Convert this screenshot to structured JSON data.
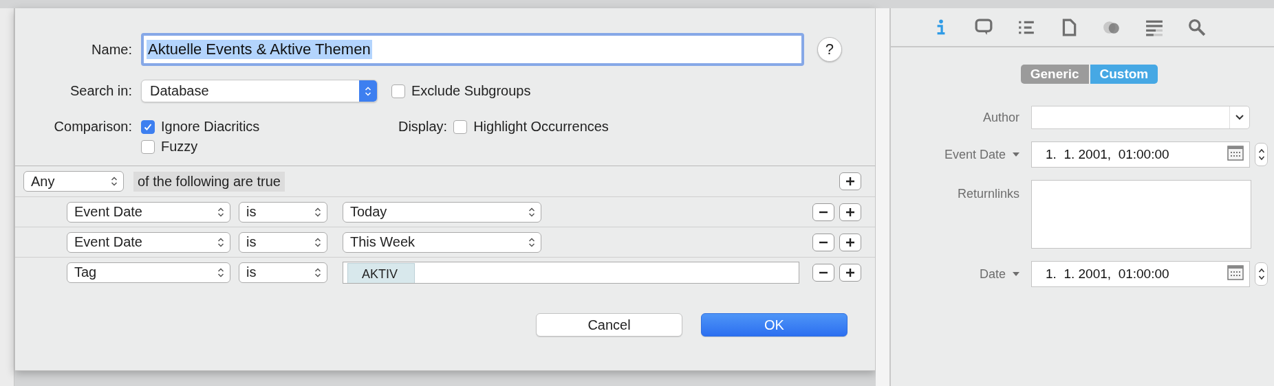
{
  "dialog": {
    "name_field": {
      "label": "Name:",
      "value": "Aktuelle Events & Aktive Themen",
      "help": "?"
    },
    "search_in": {
      "label": "Search in:",
      "value": "Database"
    },
    "exclude_subgroups": {
      "label": "Exclude Subgroups",
      "checked": false
    },
    "comparison": {
      "label": "Comparison:",
      "options": [
        {
          "label": "Ignore Diacritics",
          "checked": true
        },
        {
          "label": "Fuzzy",
          "checked": false
        }
      ]
    },
    "display": {
      "label": "Display:",
      "options": [
        {
          "label": "Highlight Occurrences",
          "checked": false
        }
      ]
    },
    "rules": {
      "match": "Any",
      "match_text": "of the following are true",
      "conditions": [
        {
          "field": "Event Date",
          "operator": "is",
          "kind": "popup",
          "value": "Today"
        },
        {
          "field": "Event Date",
          "operator": "is",
          "kind": "popup",
          "value": "This Week"
        },
        {
          "field": "Tag",
          "operator": "is",
          "kind": "tags",
          "value": "AKTIV"
        }
      ]
    },
    "buttons": [
      {
        "label": "Cancel",
        "default": false
      },
      {
        "label": "OK",
        "default": true
      }
    ]
  },
  "inspector": {
    "tabs": [
      {
        "selected": true
      },
      {
        "selected": false
      },
      {
        "selected": false
      },
      {
        "selected": false
      },
      {
        "selected": false
      },
      {
        "selected": false
      },
      {
        "selected": false
      }
    ],
    "segments": [
      {
        "label": "Generic",
        "selected": false
      },
      {
        "label": "Custom",
        "selected": true
      }
    ],
    "fields": [
      {
        "label": "Author",
        "kind": "combo"
      },
      {
        "label": "Event Date",
        "kind": "date",
        "value": "1.  1. 2001,  01:00:00"
      },
      {
        "label": "Returnlinks",
        "kind": "textarea"
      },
      {
        "label": "Date",
        "kind": "date",
        "value": "1.  1. 2001,  01:00:00"
      }
    ]
  }
}
